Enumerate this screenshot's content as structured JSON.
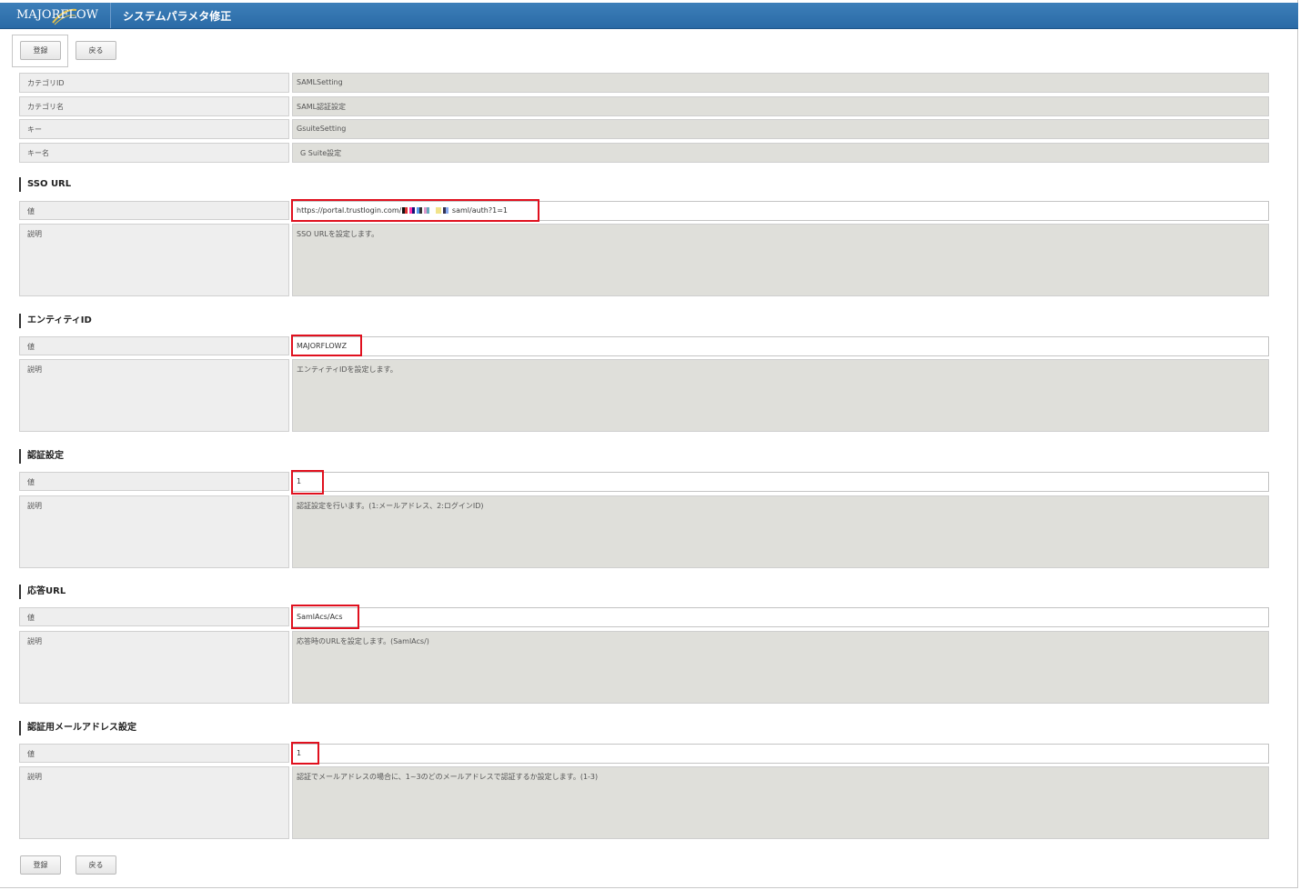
{
  "header": {
    "logo_text": "MAJORFLOW",
    "title": "システムパラメタ修正"
  },
  "toolbar": {
    "register_label": "登録",
    "back_label": "戻る"
  },
  "info_rows": [
    {
      "label": "カテゴリID",
      "value": "SAMLSetting"
    },
    {
      "label": "カテゴリ名",
      "value": "SAML認証設定"
    },
    {
      "label": "キー",
      "value": "GsuiteSetting"
    },
    {
      "label": "キー名",
      "value": "G Suite設定"
    }
  ],
  "sections": [
    {
      "title": "SSO URL",
      "value_label": "値",
      "value": "https://portal.trustlogin.com/",
      "value_suffix": "saml/auth?1=1",
      "desc_label": "説明",
      "description": "SSO URLを設定します。"
    },
    {
      "title": "エンティティID",
      "value_label": "値",
      "value": "MAJORFLOWZ",
      "desc_label": "説明",
      "description": "エンティティIDを設定します。"
    },
    {
      "title": "認証設定",
      "value_label": "値",
      "value": "1",
      "desc_label": "説明",
      "description": "認証設定を行います。(1:メールアドレス、2:ログインID)"
    },
    {
      "title": "応答URL",
      "value_label": "値",
      "value": "SamlAcs/Acs",
      "desc_label": "説明",
      "description": "応答時のURLを設定します。(SamlAcs/)"
    },
    {
      "title": "認証用メールアドレス設定",
      "value_label": "値",
      "value": "1",
      "desc_label": "説明",
      "description": "認証でメールアドレスの場合に、1~3のどのメールアドレスで認証するか設定します。(1-3)"
    }
  ],
  "colors": {
    "header": "#2f72ae",
    "highlight": "#e0101e"
  }
}
